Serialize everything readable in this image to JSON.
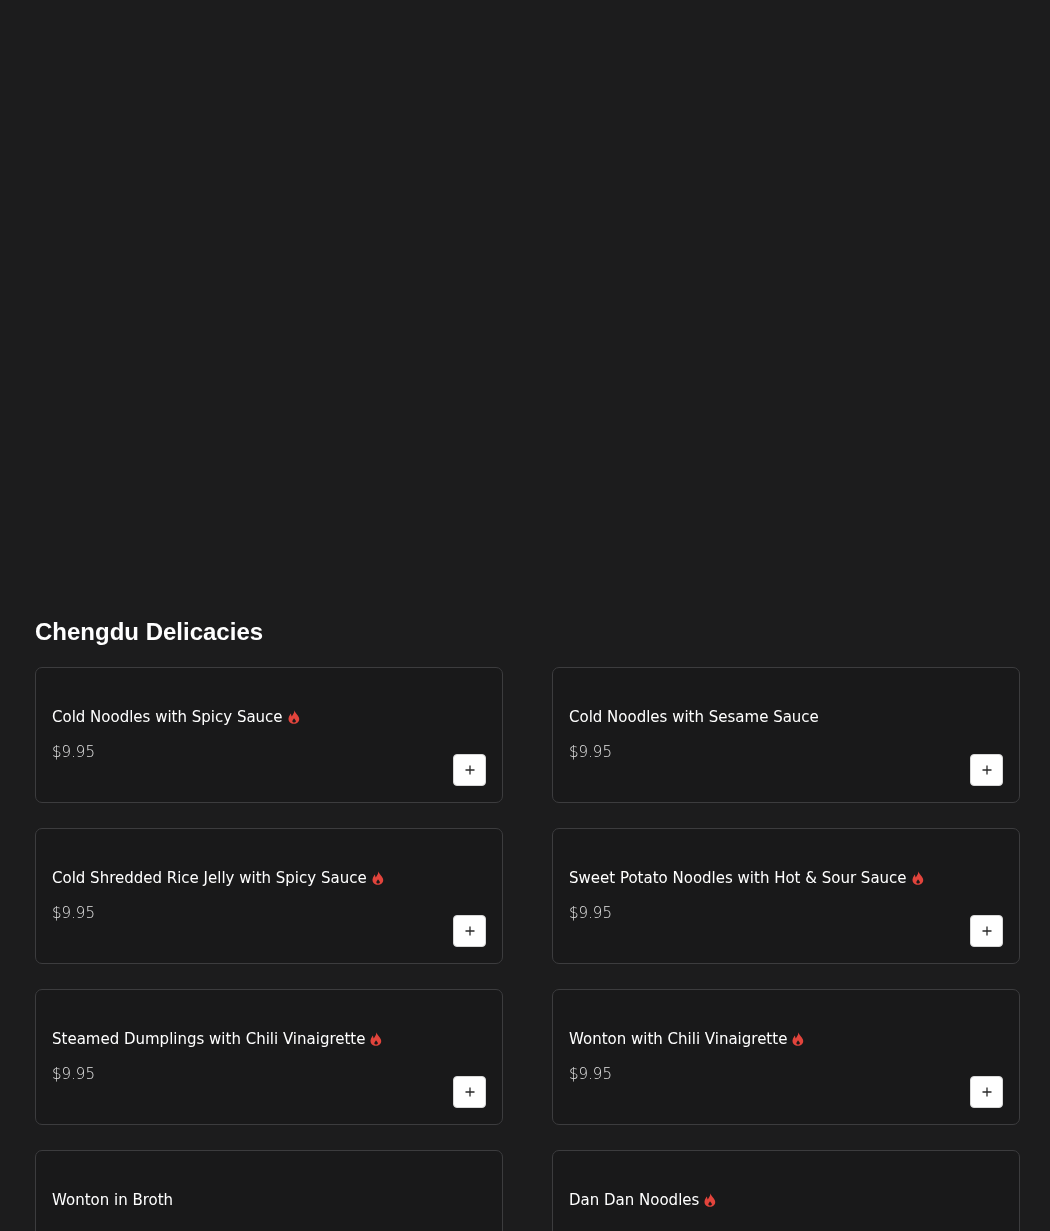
{
  "section": {
    "title": "Chengdu Delicacies"
  },
  "items": [
    {
      "name": "Cold Noodles with Spicy Sauce",
      "spicy": true,
      "price": "$9.95"
    },
    {
      "name": "Cold Noodles with Sesame Sauce",
      "spicy": false,
      "price": "$9.95"
    },
    {
      "name": "Cold Shredded Rice Jelly with Spicy Sauce",
      "spicy": true,
      "price": "$9.95"
    },
    {
      "name": "Sweet Potato Noodles with Hot & Sour Sauce",
      "spicy": true,
      "price": "$9.95"
    },
    {
      "name": "Steamed Dumplings with Chili Vinaigrette",
      "spicy": true,
      "price": "$9.95"
    },
    {
      "name": "Wonton with Chili Vinaigrette",
      "spicy": true,
      "price": "$9.95"
    },
    {
      "name": "Wonton in Broth",
      "spicy": false
    },
    {
      "name": "Dan Dan Noodles",
      "spicy": true
    }
  ]
}
